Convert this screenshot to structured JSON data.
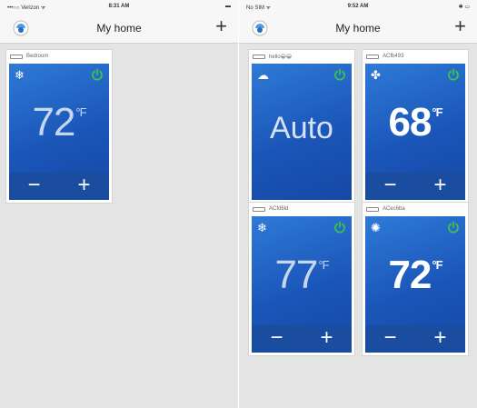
{
  "left_screen": {
    "status": {
      "carrier": "•••○○ Verizon ᯤ",
      "time": "8:31 AM",
      "battery": "▬"
    },
    "title": "My home",
    "add_label": "+",
    "cards": [
      {
        "name": "Bedroom",
        "mode_icon": "snowflake-icon",
        "mode_glyph": "❄",
        "temperature": "72",
        "unit": "°F",
        "minus": "−",
        "plus": "+"
      }
    ]
  },
  "right_screen": {
    "status": {
      "carrier": "No SIM ᯤ",
      "time": "9:52 AM",
      "battery": "✱ ▭"
    },
    "title": "My home",
    "add_label": "+",
    "cards": [
      {
        "name": "hello😀😀",
        "mode_icon": "cloud-icon",
        "mode_glyph": "☁",
        "display": "Auto",
        "minus": "−",
        "plus": "+"
      },
      {
        "name": "ACfb493",
        "mode_icon": "fan-icon",
        "mode_glyph": "✤",
        "temperature": "68",
        "unit": "°F",
        "minus": "−",
        "plus": "+"
      },
      {
        "name": "ACfd6ld",
        "mode_icon": "snowflake-icon",
        "mode_glyph": "❄",
        "temperature": "77",
        "unit": "°F",
        "minus": "−",
        "plus": "+"
      },
      {
        "name": "ACec6ba",
        "mode_icon": "heat-icon",
        "mode_glyph": "✺",
        "temperature": "72",
        "unit": "°F",
        "minus": "−",
        "plus": "+"
      }
    ]
  },
  "colors": {
    "tile_blue": "#1f5fc2",
    "control_bar": "#1a4da0",
    "power_green": "#3fc24a",
    "background": "#e4e4e4"
  }
}
